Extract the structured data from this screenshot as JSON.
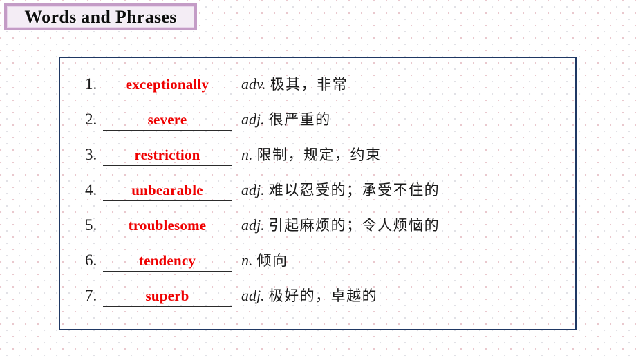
{
  "slide": {
    "title": "Words and Phrases",
    "accent_color": "#c49cc6",
    "box_border_color": "#1f3864",
    "answer_color": "#ef0000"
  },
  "word_list": {
    "items": [
      {
        "index": "1.",
        "word": "exceptionally",
        "pos": "adv.",
        "meaning": "极其，非常"
      },
      {
        "index": "2.",
        "word": "severe",
        "pos": "adj.",
        "meaning": "很严重的"
      },
      {
        "index": "3.",
        "word": "restriction",
        "pos": "n.",
        "meaning": "限制，规定，约束"
      },
      {
        "index": "4.",
        "word": "unbearable",
        "pos": "adj.",
        "meaning": "难以忍受的；承受不住的"
      },
      {
        "index": "5.",
        "word": "troublesome",
        "pos": "adj.",
        "meaning": "引起麻烦的；令人烦恼的"
      },
      {
        "index": "6.",
        "word": "tendency",
        "pos": "n.",
        "meaning": "倾向"
      },
      {
        "index": "7.",
        "word": "superb",
        "pos": "adj.",
        "meaning": "极好的，卓越的"
      }
    ]
  }
}
